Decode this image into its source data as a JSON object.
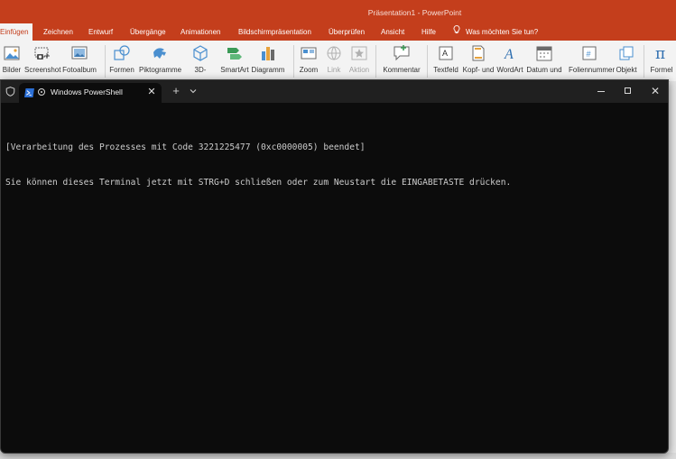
{
  "powerpoint": {
    "title": "Präsentation1 - PowerPoint",
    "tabs": [
      {
        "label": "Einfügen",
        "active": true
      },
      {
        "label": "Zeichnen"
      },
      {
        "label": "Entwurf"
      },
      {
        "label": "Übergänge"
      },
      {
        "label": "Animationen"
      },
      {
        "label": "Bildschirmpräsentation"
      },
      {
        "label": "Überprüfen"
      },
      {
        "label": "Ansicht"
      },
      {
        "label": "Hilfe"
      }
    ],
    "tell_me": "Was möchten Sie tun?",
    "ribbon": [
      {
        "label": "Bilder",
        "icon": "pictures-icon"
      },
      {
        "label": "Screenshot",
        "icon": "screenshot-icon"
      },
      {
        "label": "Fotoalbum",
        "icon": "photo-album-icon"
      },
      {
        "label": "Formen",
        "icon": "shapes-icon"
      },
      {
        "label": "Piktogramme",
        "icon": "icons-icon"
      },
      {
        "label": "3D-",
        "icon": "3d-models-icon"
      },
      {
        "label": "SmartArt",
        "icon": "smartart-icon"
      },
      {
        "label": "Diagramm",
        "icon": "chart-icon"
      },
      {
        "label": "Zoom",
        "icon": "zoom-icon"
      },
      {
        "label": "Link",
        "icon": "link-icon",
        "disabled": true
      },
      {
        "label": "Aktion",
        "icon": "action-icon",
        "disabled": true
      },
      {
        "label": "Kommentar",
        "icon": "comment-icon"
      },
      {
        "label": "Textfeld",
        "icon": "textbox-icon"
      },
      {
        "label": "Kopf- und",
        "icon": "header-footer-icon"
      },
      {
        "label": "WordArt",
        "icon": "wordart-icon"
      },
      {
        "label": "Datum und",
        "icon": "date-time-icon"
      },
      {
        "label": "Foliennummer",
        "icon": "slide-number-icon"
      },
      {
        "label": "Objekt",
        "icon": "object-icon"
      },
      {
        "label": "Formel",
        "icon": "equation-icon"
      }
    ]
  },
  "terminal": {
    "tab_title": "Windows PowerShell",
    "new_tab_label": "+",
    "close_glyph": "✕",
    "lines": [
      "[Verarbeitung des Prozesses mit Code 3221225477 (0xc0000005) beendet]",
      "Sie können dieses Terminal jetzt mit STRG+D schließen oder zum Neustart die EINGABETASTE drücken."
    ]
  },
  "colors": {
    "ppt_accent": "#c43e1c",
    "terminal_bg": "#0c0c0c",
    "terminal_text": "#cccccc"
  }
}
